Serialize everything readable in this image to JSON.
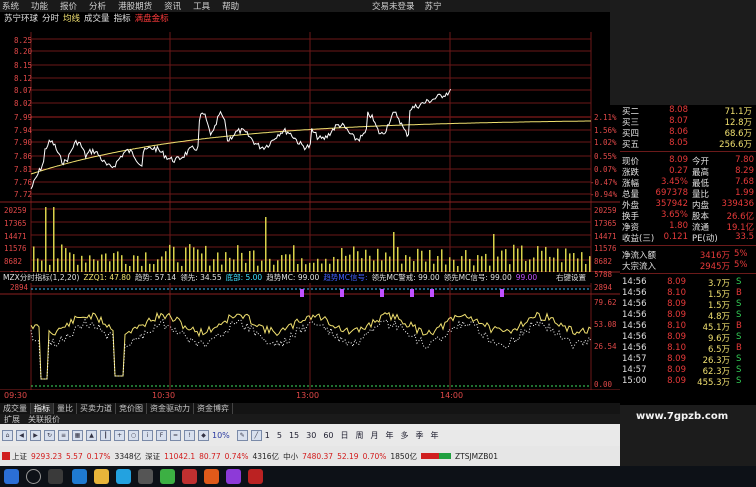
{
  "menu": [
    "系统",
    "功能",
    "报价",
    "分析",
    "港股期货",
    "资讯",
    "工具",
    "帮助"
  ],
  "menu_right": [
    "交易未登录",
    "苏宁"
  ],
  "chart_header": {
    "name": "苏宁环球",
    "tabs": [
      "分时",
      "均线",
      "成交量",
      "指标"
    ],
    "highlight": "满盘金标"
  },
  "price_axis_left": [
    "8.25",
    "8.20",
    "8.15",
    "8.12",
    "8.07",
    "8.02",
    "7.99",
    "7.94",
    "7.90",
    "7.86",
    "7.81",
    "7.76",
    "7.72"
  ],
  "price_axis_right": [
    "2.11%",
    "1.56%",
    "1.02%",
    "0.55%",
    "0.07%",
    "-0.47%",
    "-0.94%"
  ],
  "volume_axis_left": [
    "20259",
    "17365",
    "14471",
    "11576",
    "8682",
    "5788",
    "2894"
  ],
  "volume_axis_right": [
    "20259",
    "17365",
    "14471",
    "11576",
    "8682",
    "5788",
    "2894"
  ],
  "indicator_header": {
    "name": "MZX分时指标(1,2,20)",
    "items": [
      "ZZQ1: 47.80",
      "趋势: 57.14",
      "领先: 34.55",
      "底部: 5.00",
      "趋势MC: 99.00",
      "趋势MC信号:",
      "领先MC警戒: 99.00",
      "领先MC信号: 99.00",
      "99.00"
    ],
    "setting": "右键设置"
  },
  "indicator_axis_right": [
    "79.62",
    "53.08",
    "26.54",
    "0.00"
  ],
  "time_axis": [
    "09:30",
    "10:30",
    "13:00",
    "14:00"
  ],
  "tabs_bottom": [
    "成交量",
    "指标",
    "量比",
    "买卖力道",
    "竞价图",
    "资金驱动力",
    "资金博弈"
  ],
  "tabs_bottom_active": "指标",
  "tabs_second": [
    "扩展",
    "关联报价"
  ],
  "toolbar_text": [
    "1",
    "5",
    "15",
    "30",
    "60",
    "日",
    "周",
    "月",
    "年",
    "多",
    "季",
    "年"
  ],
  "toolbar_pct": "10%",
  "status": {
    "sh": "上证",
    "sh_val": "9293.23",
    "sh_chg": "5.57",
    "sh_pct": "0.17%",
    "sh_vol": "3348亿",
    "sz": "深证",
    "sz_val": "11042.1",
    "sz_chg": "80.77",
    "sz_pct": "0.74%",
    "sz_vol": "4316亿",
    "zx": "中小",
    "zx_val": "7480.37",
    "zx_chg": "52.19",
    "zx_pct": "0.70%",
    "zx_vol": "1850亿",
    "code": "ZTSJMZB01"
  },
  "quote_panel": {
    "book": [
      {
        "label": "买二",
        "price": "8.08",
        "vol": "71.1万"
      },
      {
        "label": "买三",
        "price": "8.07",
        "vol": "12.8万"
      },
      {
        "label": "买四",
        "price": "8.06",
        "vol": "68.6万"
      },
      {
        "label": "买五",
        "price": "8.05",
        "vol": "256.6万"
      }
    ],
    "stats": [
      {
        "l1": "现价",
        "v1": "8.09",
        "l2": "今开",
        "v2": "7.80"
      },
      {
        "l1": "涨跌",
        "v1": "0.27",
        "l2": "最高",
        "v2": "8.29"
      },
      {
        "l1": "涨幅",
        "v1": "3.45%",
        "l2": "最低",
        "v2": "7.68"
      },
      {
        "l1": "总量",
        "v1": "697378",
        "l2": "量比",
        "v2": "1.99"
      },
      {
        "l1": "外盘",
        "v1": "357942",
        "l2": "内盘",
        "v2": "339436"
      },
      {
        "l1": "换手",
        "v1": "3.65%",
        "l2": "股本",
        "v2": "26.6亿"
      },
      {
        "l1": "净资",
        "v1": "1.80",
        "l2": "流通",
        "v2": "19.1亿"
      },
      {
        "l1": "收益(三)",
        "v1": "0.121",
        "l2": "PE(动)",
        "v2": "33.5"
      }
    ],
    "flows": [
      {
        "label": "净流入额",
        "value": "3416万",
        "pct": "5%"
      },
      {
        "label": "大宗流入",
        "value": "2945万",
        "pct": "5%"
      }
    ],
    "ticks": [
      {
        "t": "14:56",
        "p": "8.09",
        "v": "3.7万",
        "d": "S"
      },
      {
        "t": "14:56",
        "p": "8.10",
        "v": "1.5万",
        "d": "B"
      },
      {
        "t": "14:56",
        "p": "8.09",
        "v": "1.5万",
        "d": "S"
      },
      {
        "t": "14:56",
        "p": "8.09",
        "v": "4.8万",
        "d": "S"
      },
      {
        "t": "14:56",
        "p": "8.10",
        "v": "45.1万",
        "d": "B"
      },
      {
        "t": "14:56",
        "p": "8.09",
        "v": "9.6万",
        "d": "S"
      },
      {
        "t": "14:56",
        "p": "8.10",
        "v": "6.5万",
        "d": "B"
      },
      {
        "t": "14:57",
        "p": "8.09",
        "v": "26.3万",
        "d": "S"
      },
      {
        "t": "14:57",
        "p": "8.09",
        "v": "62.3万",
        "d": "S"
      },
      {
        "t": "15:00",
        "p": "8.09",
        "v": "455.3万",
        "d": "S"
      }
    ]
  },
  "watermark": "www.7gpzb.com",
  "colors": {
    "up": "#e83a3a",
    "down": "#33cc55",
    "price_line": "#ffffff",
    "avg_line": "#f0e070",
    "grid": "#6b1818",
    "volume": "#d8d24a"
  }
}
